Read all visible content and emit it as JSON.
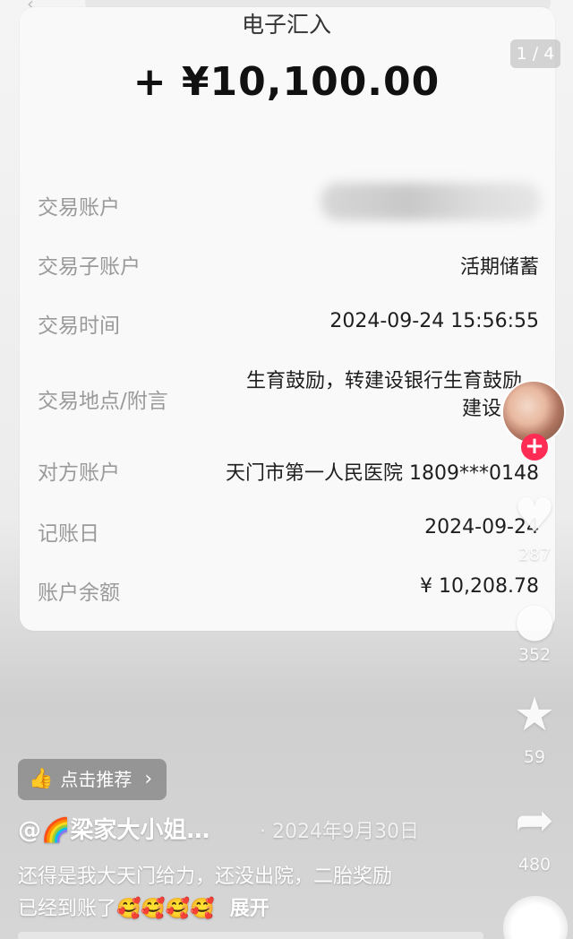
{
  "header": {
    "title": "电子汇入",
    "page_indicator": "1 / 4"
  },
  "transaction": {
    "amount": "+ ¥10,100.00",
    "rows": [
      {
        "label": "交易账户",
        "value": ""
      },
      {
        "label": "交易子账户",
        "value": "活期储蓄"
      },
      {
        "label": "交易时间",
        "value": "2024-09-24 15:56:55"
      },
      {
        "label": "交易地点/附言",
        "value_line1": "生育鼓励，转建设银行生育鼓励，",
        "value_line2": "建设"
      },
      {
        "label": "对方账户",
        "value": "天门市第一人民医院 1809***0148"
      },
      {
        "label": "记账日",
        "value": "2024-09-24"
      },
      {
        "label": "账户余额",
        "value": "¥ 10,208.78"
      }
    ]
  },
  "rail": {
    "avatar_icon": "creator-avatar",
    "follow_icon": "plus-icon",
    "like_count": "287",
    "comment_count": "352",
    "favorite_count": "59",
    "share_count": "480"
  },
  "post": {
    "recommend_label": "点击推荐",
    "author": "@🌈梁家大小姐…",
    "date": "· 2024年9月30日",
    "caption_line1": "还得是我大天门给力，还没出院，二胎奖励",
    "caption_line2": "已经到账了🥰🥰🥰🥰",
    "expand_label": "展开"
  }
}
